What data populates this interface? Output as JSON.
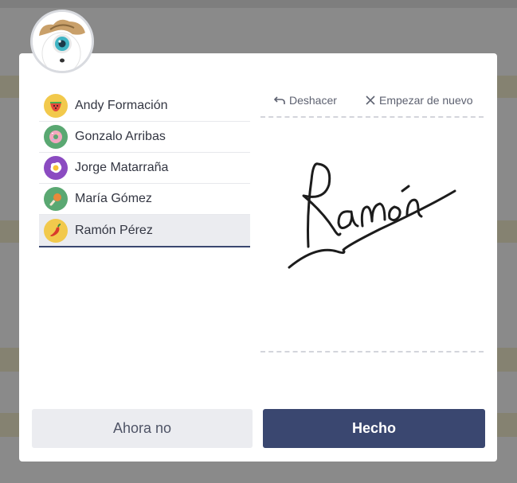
{
  "users": [
    {
      "name": "Andy Formación",
      "icon": "watermelon-icon",
      "color": "#f2c94c"
    },
    {
      "name": "Gonzalo Arribas",
      "icon": "donut-icon",
      "color": "#5aa872"
    },
    {
      "name": "Jorge Matarraña",
      "icon": "fried-egg-icon",
      "color": "#8b4bc1"
    },
    {
      "name": "María Gómez",
      "icon": "chicken-leg-icon",
      "color": "#5aa872"
    },
    {
      "name": "Ramón Pérez",
      "icon": "chili-pepper-icon",
      "color": "#f2c94c",
      "selected": true
    }
  ],
  "toolbar": {
    "undo_label": "Deshacer",
    "clear_label": "Empezar de nuevo"
  },
  "actions": {
    "cancel_label": "Ahora no",
    "done_label": "Hecho"
  },
  "colors": {
    "primary": "#3a4770",
    "secondary": "#ebecf0",
    "overlay": "#8a8a8a"
  }
}
